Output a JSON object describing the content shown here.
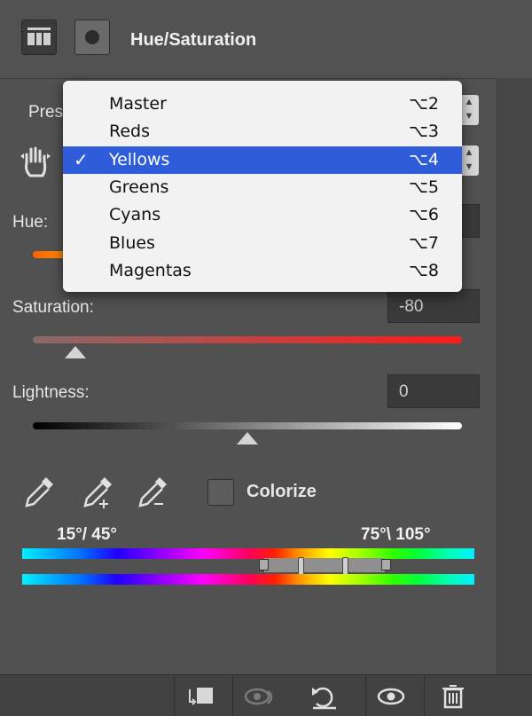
{
  "header": {
    "title": "Hue/Saturation",
    "adjustment_icon": "adjustment-layer-icon",
    "mask_icon": "layer-mask-icon"
  },
  "preset": {
    "label_partial": "Prese"
  },
  "hue": {
    "label": "Hue:"
  },
  "saturation": {
    "label": "Saturation:",
    "value": "-80",
    "thumb_fraction": 0.1
  },
  "lightness": {
    "label": "Lightness:",
    "value": "0",
    "thumb_fraction": 0.5
  },
  "colorize": {
    "label": "Colorize",
    "checked": false
  },
  "range": {
    "left_label": "15°/ 45°",
    "right_label": "75°\\ 105°"
  },
  "channel_menu": {
    "items": [
      {
        "name": "Master",
        "shortcut": "⌥2",
        "selected": false
      },
      {
        "name": "Reds",
        "shortcut": "⌥3",
        "selected": false
      },
      {
        "name": "Yellows",
        "shortcut": "⌥4",
        "selected": true
      },
      {
        "name": "Greens",
        "shortcut": "⌥5",
        "selected": false
      },
      {
        "name": "Cyans",
        "shortcut": "⌥6",
        "selected": false
      },
      {
        "name": "Blues",
        "shortcut": "⌥7",
        "selected": false
      },
      {
        "name": "Magentas",
        "shortcut": "⌥8",
        "selected": false
      }
    ],
    "check_mark": "✓",
    "selected_color": "#2f5dd9"
  },
  "toolbar": {
    "buttons": [
      "clip-to-layer-icon",
      "view-previous-state-icon",
      "reset-icon",
      "visibility-eye-icon",
      "trash-icon"
    ]
  }
}
